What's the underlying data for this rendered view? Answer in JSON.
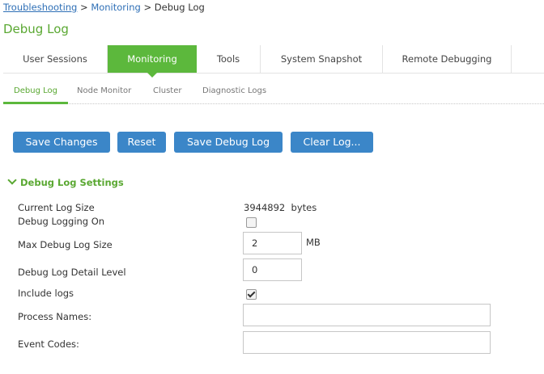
{
  "breadcrumb": {
    "item1": "Troubleshooting",
    "sep1": ">",
    "item2": "Monitoring",
    "sep2": ">",
    "current": "Debug Log"
  },
  "page_title": "Debug Log",
  "tabs": [
    {
      "label": "User Sessions"
    },
    {
      "label": "Monitoring",
      "active": true
    },
    {
      "label": "Tools"
    },
    {
      "label": "System Snapshot"
    },
    {
      "label": "Remote Debugging"
    }
  ],
  "subtabs": [
    {
      "label": "Debug Log",
      "active": true
    },
    {
      "label": "Node Monitor"
    },
    {
      "label": "Cluster"
    },
    {
      "label": "Diagnostic Logs"
    }
  ],
  "buttons": {
    "save_changes": "Save Changes",
    "reset": "Reset",
    "save_debug_log": "Save Debug Log",
    "clear_log": "Clear Log..."
  },
  "settings": {
    "header": "Debug Log Settings",
    "current_log_size_label": "Current Log Size",
    "current_log_size_value": "3944892",
    "current_log_size_unit": "bytes",
    "debug_logging_on_label": "Debug Logging On",
    "debug_logging_on_checked": false,
    "max_size_label": "Max Debug Log Size",
    "max_size_value": "2",
    "max_size_unit": "MB",
    "detail_level_label": "Debug Log Detail Level",
    "detail_level_value": "0",
    "include_logs_label": "Include logs",
    "include_logs_checked": true,
    "process_names_label": "Process Names:",
    "process_names_value": "",
    "event_codes_label": "Event Codes:",
    "event_codes_value": ""
  },
  "colors": {
    "accent_green": "#5cb83c",
    "button_blue": "#3b86c8",
    "link_blue": "#2e6fb6"
  }
}
